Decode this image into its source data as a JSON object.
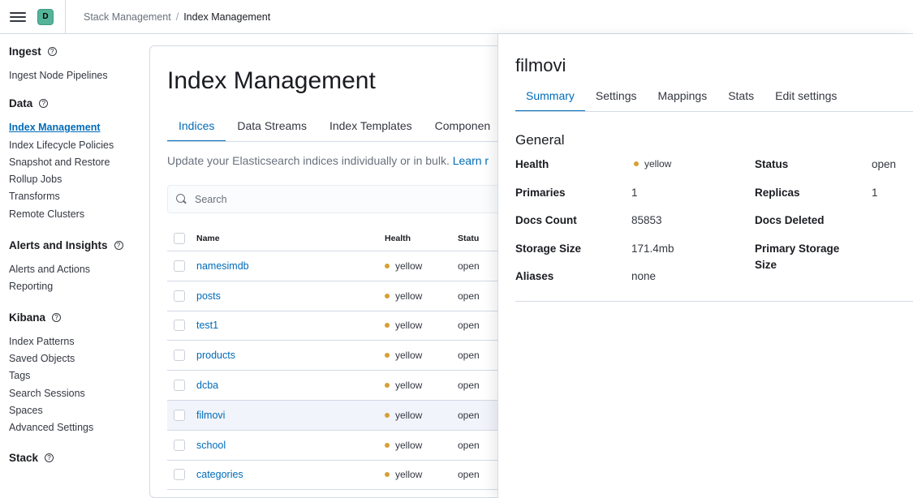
{
  "header": {
    "space_initial": "D",
    "breadcrumbs": [
      "Stack Management",
      "Index Management"
    ]
  },
  "sidebar": {
    "sections": [
      {
        "title": "Ingest",
        "items": [
          "Ingest Node Pipelines"
        ]
      },
      {
        "title": "Data",
        "items": [
          "Index Management",
          "Index Lifecycle Policies",
          "Snapshot and Restore",
          "Rollup Jobs",
          "Transforms",
          "Remote Clusters"
        ],
        "active": "Index Management"
      },
      {
        "title": "Alerts and Insights",
        "items": [
          "Alerts and Actions",
          "Reporting"
        ]
      },
      {
        "title": "Kibana",
        "items": [
          "Index Patterns",
          "Saved Objects",
          "Tags",
          "Search Sessions",
          "Spaces",
          "Advanced Settings"
        ]
      },
      {
        "title": "Stack",
        "items": []
      }
    ]
  },
  "main": {
    "title": "Index Management",
    "tabs": [
      "Indices",
      "Data Streams",
      "Index Templates",
      "Componen"
    ],
    "active_tab": "Indices",
    "description": "Update your Elasticsearch indices individually or in bulk.",
    "description_link": "Learn r",
    "search_placeholder": "Search",
    "table": {
      "columns": [
        "Name",
        "Health",
        "Statu"
      ],
      "rows": [
        {
          "name": "namesimdb",
          "health": "yellow",
          "status": "open"
        },
        {
          "name": "posts",
          "health": "yellow",
          "status": "open"
        },
        {
          "name": "test1",
          "health": "yellow",
          "status": "open"
        },
        {
          "name": "products",
          "health": "yellow",
          "status": "open"
        },
        {
          "name": "dcba",
          "health": "yellow",
          "status": "open"
        },
        {
          "name": "filmovi",
          "health": "yellow",
          "status": "open",
          "selected": true
        },
        {
          "name": "school",
          "health": "yellow",
          "status": "open"
        },
        {
          "name": "categories",
          "health": "yellow",
          "status": "open"
        }
      ]
    }
  },
  "flyout": {
    "title": "filmovi",
    "tabs": [
      "Summary",
      "Settings",
      "Mappings",
      "Stats",
      "Edit settings"
    ],
    "active_tab": "Summary",
    "section_title": "General",
    "fields": {
      "health_label": "Health",
      "health_value": "yellow",
      "status_label": "Status",
      "status_value": "open",
      "primaries_label": "Primaries",
      "primaries_value": "1",
      "replicas_label": "Replicas",
      "replicas_value": "1",
      "docs_count_label": "Docs Count",
      "docs_count_value": "85853",
      "docs_deleted_label": "Docs Deleted",
      "storage_size_label": "Storage Size",
      "storage_size_value": "171.4mb",
      "primary_storage_label_1": "Primary Storage",
      "primary_storage_label_2": "Size",
      "aliases_label": "Aliases",
      "aliases_value": "none"
    }
  },
  "colors": {
    "accent": "#006bb8",
    "health_yellow": "#d6a035",
    "space_avatar": "#54b399"
  }
}
